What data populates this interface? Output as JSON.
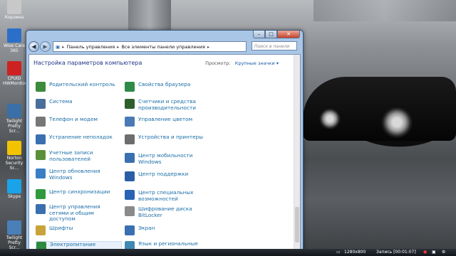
{
  "desktop": {
    "icons": [
      {
        "label": "Корзина",
        "icon": "recycle-bin-icon",
        "color": "#c8c8c8"
      },
      {
        "label": "Wise Care 365",
        "icon": "wise-care-icon",
        "color": "#2b6fc9"
      },
      {
        "label": "CPUID HWMonitor",
        "icon": "hwmonitor-icon",
        "color": "#cc2222"
      },
      {
        "label": "Twilight Pretty Scr...",
        "icon": "screenshot-app-icon",
        "color": "#3a6fa8"
      },
      {
        "label": "Norton Security Sc...",
        "icon": "norton-icon",
        "color": "#f2c300"
      },
      {
        "label": "Skype",
        "icon": "skype-icon",
        "color": "#1aa3e8"
      },
      {
        "label": "Twilight Pretty Scr...",
        "icon": "screenshot-app-icon-2",
        "color": "#4a7fb8"
      }
    ]
  },
  "window": {
    "caption_buttons": {
      "minimize": "–",
      "maximize": "□",
      "close": "✕"
    },
    "nav": {
      "back": "◀",
      "forward": "▶"
    },
    "breadcrumb": [
      "Панель управления",
      "Все элементы панели управления"
    ],
    "search_placeholder": "Поиск в панели упр...",
    "heading": "Настройка параметров компьютера",
    "view_by_label": "Просмотр:",
    "view_by_value": "Крупные значки ▾",
    "items_left": [
      {
        "label": "Родительский контроль",
        "icon": "parental-controls-icon",
        "color": "#3c8a3c"
      },
      {
        "label": "Система",
        "icon": "system-icon",
        "color": "#4a6e9a"
      },
      {
        "label": "Телефон и модем",
        "icon": "phone-modem-icon",
        "color": "#777777"
      },
      {
        "label": "Устранение неполадок",
        "icon": "troubleshooting-icon",
        "color": "#3a6fb0"
      },
      {
        "label": "Учетные записи пользователей",
        "icon": "user-accounts-icon",
        "color": "#5b8f3a"
      },
      {
        "label": "Центр обновления Windows",
        "icon": "windows-update-icon",
        "color": "#3a7ec4"
      },
      {
        "label": "Центр синхронизации",
        "icon": "sync-center-icon",
        "color": "#2e9a3c"
      },
      {
        "label": "Центр управления сетями и общим доступом",
        "icon": "network-center-icon",
        "color": "#3a6fb0"
      },
      {
        "label": "Шрифты",
        "icon": "fonts-icon",
        "color": "#c9a23a"
      },
      {
        "label": "Электропитание",
        "icon": "power-options-icon",
        "color": "#2f8a3f"
      }
    ],
    "items_right": [
      {
        "label": "Свойства браузера",
        "icon": "internet-options-icon",
        "color": "#2f8a4a"
      },
      {
        "label": "Счетчики и средства производительности",
        "icon": "performance-icon",
        "color": "#2d5f2d"
      },
      {
        "label": "Управление цветом",
        "icon": "color-management-icon",
        "color": "#4a7ab5"
      },
      {
        "label": "Устройства и принтеры",
        "icon": "devices-printers-icon",
        "color": "#6d6d6d"
      },
      {
        "label": "Центр мобильности Windows",
        "icon": "mobility-center-icon",
        "color": "#3a6fb0"
      },
      {
        "label": "Центр поддержки",
        "icon": "action-center-icon",
        "color": "#2a5fa8"
      },
      {
        "label": "Центр специальных возможностей",
        "icon": "ease-of-access-icon",
        "color": "#2a62b4"
      },
      {
        "label": "Шифрование диска BitLocker",
        "icon": "bitlocker-icon",
        "color": "#8a8a8a"
      },
      {
        "label": "Экран",
        "icon": "display-icon",
        "color": "#3a6fb0"
      },
      {
        "label": "Язык и региональные стандарты",
        "icon": "region-language-icon",
        "color": "#3f8ab5"
      }
    ]
  },
  "taskbar": {
    "resolution": "1280x800",
    "recording": "Запись [00:01:07]"
  }
}
